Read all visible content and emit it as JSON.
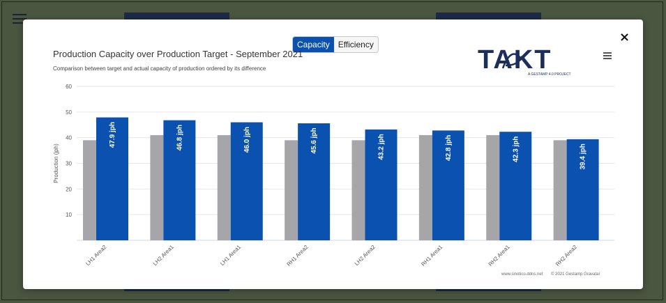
{
  "background": {
    "menu_icon": "hamburger-icon"
  },
  "modal": {
    "toggle": {
      "options": [
        "Capacity",
        "Efficiency"
      ],
      "active": "Capacity"
    },
    "close_label": "×",
    "menu_icon": "hamburger-icon",
    "logo": {
      "text": "TAKT",
      "tagline": "A GESTAMP 4.0 PROJECT",
      "color": "#1c2f5a"
    },
    "credits": {
      "site": "www.sinotico.ddns.net",
      "copyright": "© 2021",
      "company": "Gestamp Gravataí"
    }
  },
  "chart_data": {
    "type": "bar",
    "title": "Production Capacity over Production Target - September 2021",
    "subtitle": "Comparison between target and actual capacity of production ordered by its difference",
    "ylabel": "Production (jph)",
    "xlabel": "",
    "ylim": [
      0,
      60
    ],
    "yticks": [
      10,
      20,
      30,
      40,
      50,
      60
    ],
    "grid": true,
    "categories": [
      "LH1 Area2",
      "LH2 Area1",
      "LH1 Area1",
      "RH1 Area2",
      "LH2 Area2",
      "RH1 Area1",
      "RH2 Area1",
      "RH2 Area2"
    ],
    "series": [
      {
        "values": [
          39,
          41,
          41,
          39,
          39,
          41,
          41,
          39
        ],
        "color": "#a6a6aa"
      },
      {
        "values": [
          47.9,
          46.8,
          46.0,
          45.6,
          43.2,
          42.8,
          42.3,
          39.4
        ],
        "color": "#0a51b0",
        "data_labels": [
          "47.9 jph",
          "46.8 jph",
          "46.0 jph",
          "45.6 jph",
          "43.2 jph",
          "42.8 jph",
          "42.3 jph",
          "39.4 jph"
        ]
      }
    ]
  }
}
